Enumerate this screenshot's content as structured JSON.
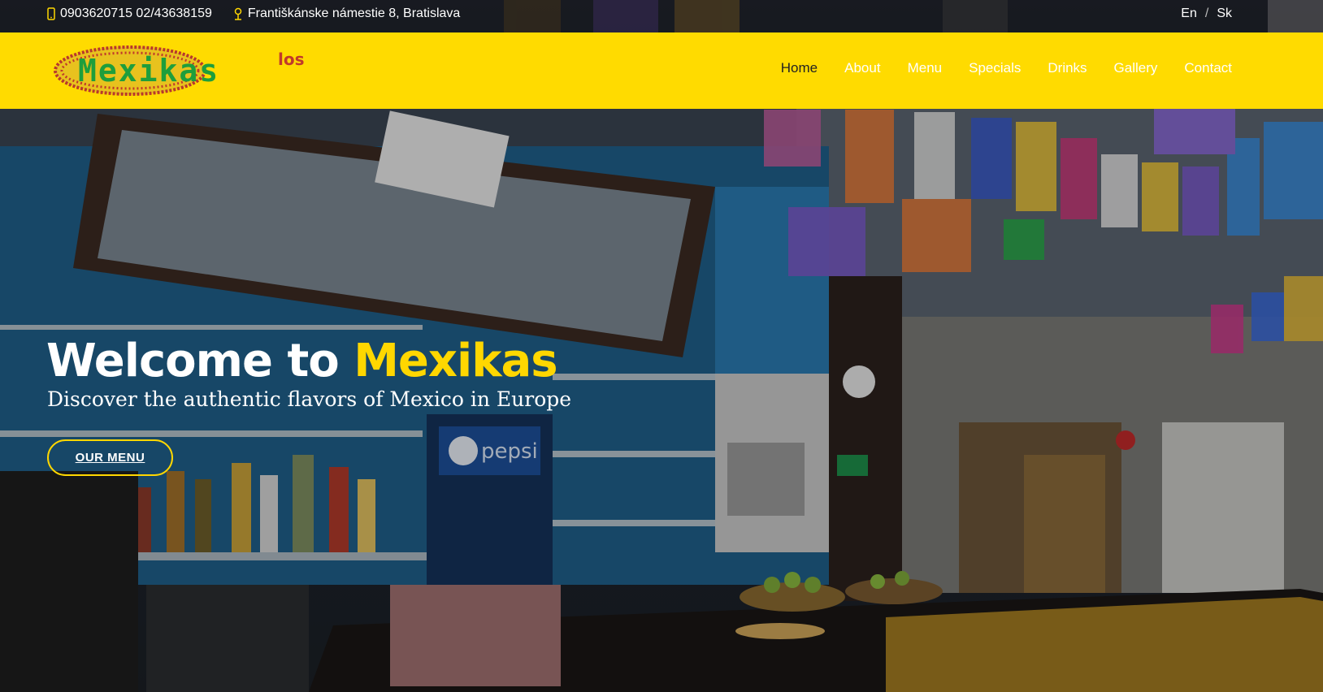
{
  "topbar": {
    "phone": "0903620715 02/43638159",
    "address": "Františkánske námestie 8, Bratislava",
    "phone_icon": "mobile-phone-icon",
    "address_icon": "map-marker-icon",
    "languages": [
      "En",
      "Sk"
    ],
    "lang_separator": "/"
  },
  "header": {
    "logo": {
      "small_text": "los",
      "main_text": "Mexikas"
    },
    "nav": [
      "Home",
      "About",
      "Menu",
      "Specials",
      "Drinks",
      "Gallery",
      "Contact"
    ],
    "active_nav": "Home"
  },
  "hero": {
    "title_prefix": "Welcome to ",
    "title_brand": "Mexikas",
    "subtitle": "Discover the authentic flavors of Mexico in Europe",
    "button_label": "OUR MENU"
  },
  "colors": {
    "accent": "#ffd700",
    "header_bg": "#ffdb00",
    "logo_green": "#1e9e3c",
    "logo_red": "#c0392b"
  }
}
